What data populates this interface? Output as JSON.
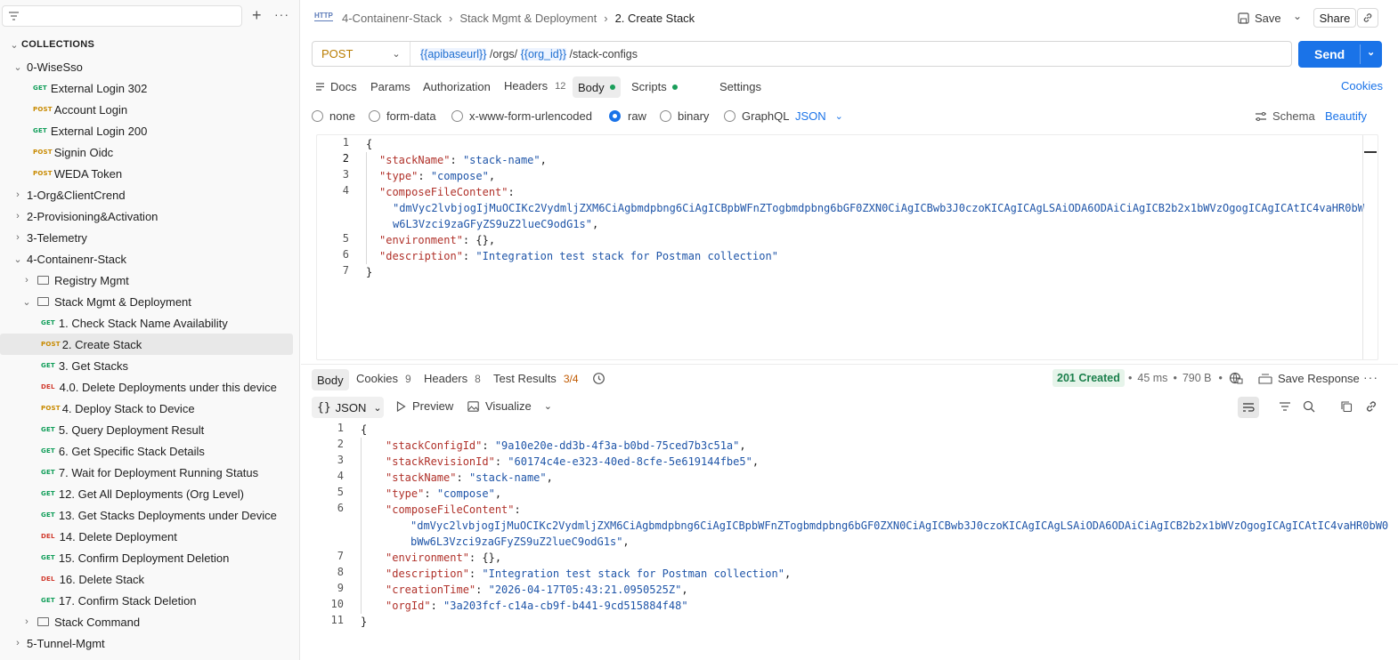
{
  "sidebar": {
    "section_title": "COLLECTIONS",
    "items": [
      {
        "label": "0-WiseSso",
        "kind": "collection",
        "open": true,
        "level": 0
      },
      {
        "label": "External Login 302",
        "kind": "request",
        "method": "GET",
        "level": 1
      },
      {
        "label": "Account Login",
        "kind": "request",
        "method": "POST",
        "level": 1
      },
      {
        "label": "External Login 200",
        "kind": "request",
        "method": "GET",
        "level": 1
      },
      {
        "label": "Signin Oidc",
        "kind": "request",
        "method": "POST",
        "level": 1
      },
      {
        "label": "WEDA Token",
        "kind": "request",
        "method": "POST",
        "level": 1
      },
      {
        "label": "1-Org&ClientCrend",
        "kind": "collection",
        "open": false,
        "level": 0
      },
      {
        "label": "2-Provisioning&Activation",
        "kind": "collection",
        "open": false,
        "level": 0
      },
      {
        "label": "3-Telemetry",
        "kind": "collection",
        "open": false,
        "level": 0
      },
      {
        "label": "4-Containenr-Stack",
        "kind": "collection",
        "open": true,
        "level": 0
      },
      {
        "label": "Registry Mgmt",
        "kind": "folder",
        "open": false,
        "level": 1
      },
      {
        "label": "Stack Mgmt & Deployment",
        "kind": "folder",
        "open": true,
        "level": 1
      },
      {
        "label": "1. Check Stack Name Availability",
        "kind": "request",
        "method": "GET",
        "level": 2
      },
      {
        "label": "2. Create Stack",
        "kind": "request",
        "method": "POST",
        "level": 2,
        "selected": true
      },
      {
        "label": "3. Get Stacks",
        "kind": "request",
        "method": "GET",
        "level": 2
      },
      {
        "label": "4.0. Delete Deployments under this device",
        "kind": "request",
        "method": "DEL",
        "level": 2
      },
      {
        "label": "4. Deploy Stack to Device",
        "kind": "request",
        "method": "POST",
        "level": 2
      },
      {
        "label": "5. Query Deployment Result",
        "kind": "request",
        "method": "GET",
        "level": 2
      },
      {
        "label": "6. Get Specific Stack Details",
        "kind": "request",
        "method": "GET",
        "level": 2
      },
      {
        "label": "7. Wait for Deployment Running Status",
        "kind": "request",
        "method": "GET",
        "level": 2
      },
      {
        "label": "12. Get All Deployments (Org Level)",
        "kind": "request",
        "method": "GET",
        "level": 2
      },
      {
        "label": "13. Get Stacks Deployments under Device",
        "kind": "request",
        "method": "GET",
        "level": 2
      },
      {
        "label": "14. Delete Deployment",
        "kind": "request",
        "method": "DEL",
        "level": 2
      },
      {
        "label": "15. Confirm Deployment Deletion",
        "kind": "request",
        "method": "GET",
        "level": 2
      },
      {
        "label": "16. Delete Stack",
        "kind": "request",
        "method": "DEL",
        "level": 2
      },
      {
        "label": "17. Confirm Stack Deletion",
        "kind": "request",
        "method": "GET",
        "level": 2
      },
      {
        "label": "Stack Command",
        "kind": "folder",
        "open": false,
        "level": 1
      },
      {
        "label": "5-Tunnel-Mgmt",
        "kind": "collection",
        "open": false,
        "level": 0
      }
    ]
  },
  "header": {
    "protocol_badge": "HTTP",
    "breadcrumb": [
      "4-Containenr-Stack",
      "Stack Mgmt & Deployment",
      "2. Create Stack"
    ],
    "save_label": "Save",
    "share_label": "Share"
  },
  "request": {
    "method": "POST",
    "url_parts": [
      {
        "text": "{{apibaseurl}}",
        "var": true
      },
      {
        "text": " /orgs/ ",
        "var": false
      },
      {
        "text": "{{org_id}}",
        "var": true
      },
      {
        "text": " /stack-configs",
        "var": false
      }
    ],
    "send_label": "Send"
  },
  "request_tabs": {
    "docs": "Docs",
    "params": "Params",
    "authorization": "Authorization",
    "headers": "Headers",
    "headers_count": "12",
    "body": "Body",
    "scripts": "Scripts",
    "settings": "Settings",
    "cookies": "Cookies"
  },
  "body_modes": {
    "none": "none",
    "form_data": "form-data",
    "urlencoded": "x-www-form-urlencoded",
    "raw": "raw",
    "binary": "binary",
    "graphql": "GraphQL",
    "format": "JSON",
    "schema": "Schema",
    "beautify": "Beautify",
    "selected": "raw"
  },
  "request_body": [
    {
      "n": "1",
      "indent": 0,
      "parts": [
        {
          "t": "{",
          "c": "p"
        }
      ]
    },
    {
      "n": "2",
      "indent": 1,
      "parts": [
        {
          "t": "\"stackName\"",
          "c": "k"
        },
        {
          "t": ": ",
          "c": "p"
        },
        {
          "t": "\"stack-name\"",
          "c": "s"
        },
        {
          "t": ",",
          "c": "p"
        }
      ]
    },
    {
      "n": "3",
      "indent": 1,
      "parts": [
        {
          "t": "\"type\"",
          "c": "k"
        },
        {
          "t": ": ",
          "c": "p"
        },
        {
          "t": "\"compose\"",
          "c": "s"
        },
        {
          "t": ",",
          "c": "p"
        }
      ]
    },
    {
      "n": "4",
      "indent": 1,
      "parts": [
        {
          "t": "\"composeFileContent\"",
          "c": "k"
        },
        {
          "t": ":",
          "c": "p"
        }
      ]
    },
    {
      "n": "",
      "indent": 2,
      "parts": [
        {
          "t": "\"dmVyc2lvbjogIjMuOCIKc2VydmljZXM6CiAgbmdpbng6CiAgICBpbWFnZTogbmdpbng6bGF0ZXN0CiAgICBwb3J0czoKICAgICAgLSAiODA6ODAiCiAgICB2b2x1bWVzOgogICAgICAtIC4vaHR0bW",
          "c": "s"
        }
      ]
    },
    {
      "n": "",
      "indent": 2,
      "parts": [
        {
          "t": "w6L3Vzci9zaGFyZS9uZ2lueC9odG1s\"",
          "c": "s"
        },
        {
          "t": ",",
          "c": "p"
        }
      ]
    },
    {
      "n": "5",
      "indent": 1,
      "parts": [
        {
          "t": "\"environment\"",
          "c": "k"
        },
        {
          "t": ": {},",
          "c": "p"
        }
      ]
    },
    {
      "n": "6",
      "indent": 1,
      "parts": [
        {
          "t": "\"description\"",
          "c": "k"
        },
        {
          "t": ": ",
          "c": "p"
        },
        {
          "t": "\"Integration test stack for Postman collection\"",
          "c": "s"
        }
      ]
    },
    {
      "n": "7",
      "indent": 0,
      "parts": [
        {
          "t": "}",
          "c": "p"
        }
      ]
    }
  ],
  "response_tabs": {
    "body": "Body",
    "cookies": "Cookies",
    "cookies_count": "9",
    "headers": "Headers",
    "headers_count": "8",
    "test_results": "Test Results",
    "test_count": "3/4",
    "status": "201 Created",
    "time": "45 ms",
    "size": "790 B",
    "save_response": "Save Response"
  },
  "response_toolbar": {
    "format": "JSON",
    "preview": "Preview",
    "visualize": "Visualize"
  },
  "response_body": [
    {
      "n": "1",
      "indent": 0,
      "parts": [
        {
          "t": "{",
          "c": "p"
        }
      ]
    },
    {
      "n": "2",
      "indent": 1,
      "parts": [
        {
          "t": "\"stackConfigId\"",
          "c": "k"
        },
        {
          "t": ": ",
          "c": "p"
        },
        {
          "t": "\"9a10e20e-dd3b-4f3a-b0bd-75ced7b3c51a\"",
          "c": "s"
        },
        {
          "t": ",",
          "c": "p"
        }
      ]
    },
    {
      "n": "3",
      "indent": 1,
      "parts": [
        {
          "t": "\"stackRevisionId\"",
          "c": "k"
        },
        {
          "t": ": ",
          "c": "p"
        },
        {
          "t": "\"60174c4e-e323-40ed-8cfe-5e619144fbe5\"",
          "c": "s"
        },
        {
          "t": ",",
          "c": "p"
        }
      ]
    },
    {
      "n": "4",
      "indent": 1,
      "parts": [
        {
          "t": "\"stackName\"",
          "c": "k"
        },
        {
          "t": ": ",
          "c": "p"
        },
        {
          "t": "\"stack-name\"",
          "c": "s"
        },
        {
          "t": ",",
          "c": "p"
        }
      ]
    },
    {
      "n": "5",
      "indent": 1,
      "parts": [
        {
          "t": "\"type\"",
          "c": "k"
        },
        {
          "t": ": ",
          "c": "p"
        },
        {
          "t": "\"compose\"",
          "c": "s"
        },
        {
          "t": ",",
          "c": "p"
        }
      ]
    },
    {
      "n": "6",
      "indent": 1,
      "parts": [
        {
          "t": "\"composeFileContent\"",
          "c": "k"
        },
        {
          "t": ":",
          "c": "p"
        }
      ]
    },
    {
      "n": "",
      "indent": 2,
      "parts": [
        {
          "t": "\"dmVyc2lvbjogIjMuOCIKc2VydmljZXM6CiAgbmdpbng6CiAgICBpbWFnZTogbmdpbng6bGF0ZXN0CiAgICBwb3J0czoKICAgICAgLSAiODA6ODAiCiAgICB2b2x1bWVzOgogICAgICAtIC4vaHR0bW0",
          "c": "s"
        }
      ]
    },
    {
      "n": "",
      "indent": 2,
      "parts": [
        {
          "t": "bWw6L3Vzci9zaGFyZS9uZ2lueC9odG1s\"",
          "c": "s"
        },
        {
          "t": ",",
          "c": "p"
        }
      ]
    },
    {
      "n": "7",
      "indent": 1,
      "parts": [
        {
          "t": "\"environment\"",
          "c": "k"
        },
        {
          "t": ": {},",
          "c": "p"
        }
      ]
    },
    {
      "n": "8",
      "indent": 1,
      "parts": [
        {
          "t": "\"description\"",
          "c": "k"
        },
        {
          "t": ": ",
          "c": "p"
        },
        {
          "t": "\"Integration test stack for Postman collection\"",
          "c": "s"
        },
        {
          "t": ",",
          "c": "p"
        }
      ]
    },
    {
      "n": "9",
      "indent": 1,
      "parts": [
        {
          "t": "\"creationTime\"",
          "c": "k"
        },
        {
          "t": ": ",
          "c": "p"
        },
        {
          "t": "\"2026-04-17T05:43:21.0950525Z\"",
          "c": "s"
        },
        {
          "t": ",",
          "c": "p"
        }
      ]
    },
    {
      "n": "10",
      "indent": 1,
      "parts": [
        {
          "t": "\"orgId\"",
          "c": "k"
        },
        {
          "t": ": ",
          "c": "p"
        },
        {
          "t": "\"3a203fcf-c14a-cb9f-b441-9cd515884f48\"",
          "c": "s"
        }
      ]
    },
    {
      "n": "11",
      "indent": 0,
      "parts": [
        {
          "t": "}",
          "c": "p"
        }
      ]
    }
  ],
  "colors": {
    "accent": "#1a73e8",
    "post": "#c88a00",
    "get": "#0f9d58",
    "delete": "#d13c2f",
    "status_ok": "#1a7f4b"
  }
}
